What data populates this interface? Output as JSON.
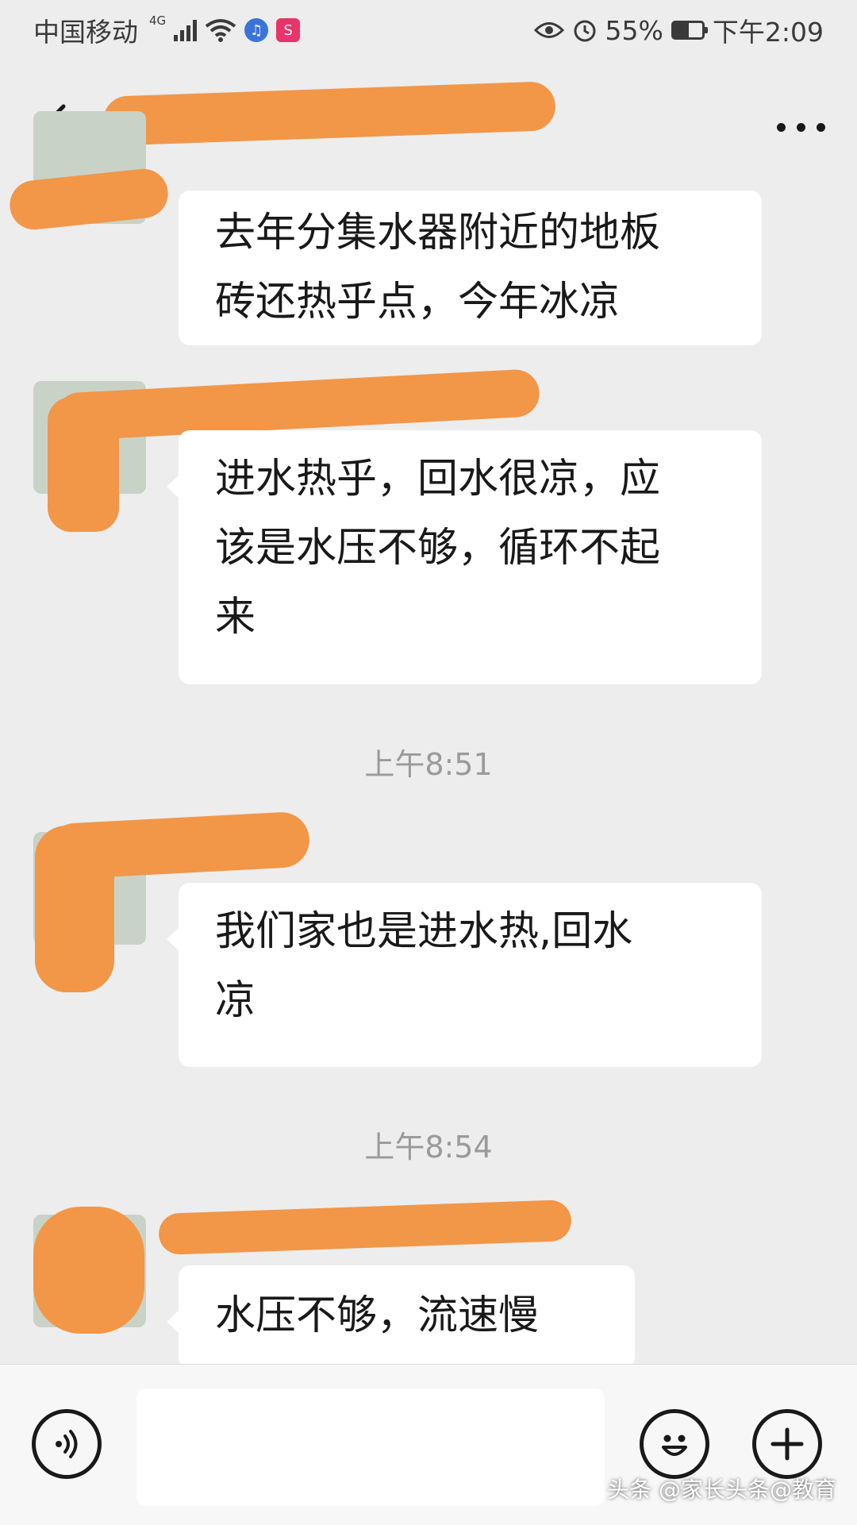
{
  "status_bar": {
    "carrier": "中国移动",
    "network": "4G",
    "battery": "55%",
    "battery_level": 0.55,
    "time": "下午2:09"
  },
  "header": {
    "back_icon": "chevron-left-icon",
    "title": "",
    "more_icon": "more-dots-icon"
  },
  "messages": [
    {
      "text_lines": [
        "去年分集水器附近的地板",
        "砖还热乎点，今年冰凉"
      ]
    },
    {
      "text_lines": [
        "进水热乎，回水很凉，应",
        "该是水压不够，循环不起",
        "来"
      ]
    },
    {
      "text_lines": [
        "我们家也是进水热,回水",
        "凉"
      ]
    },
    {
      "text_lines": [
        "水压不够，流速慢"
      ]
    }
  ],
  "timestamps": [
    "上午8:51",
    "上午8:54"
  ],
  "input_bar": {
    "voice_icon": "voice-icon",
    "emoji_icon": "emoji-icon",
    "plus_icon": "plus-icon",
    "placeholder": ""
  },
  "watermark": "头条 @家长头条@教育",
  "colors": {
    "background": "#ededed",
    "bubble": "#ffffff",
    "redaction": "#f29648"
  }
}
